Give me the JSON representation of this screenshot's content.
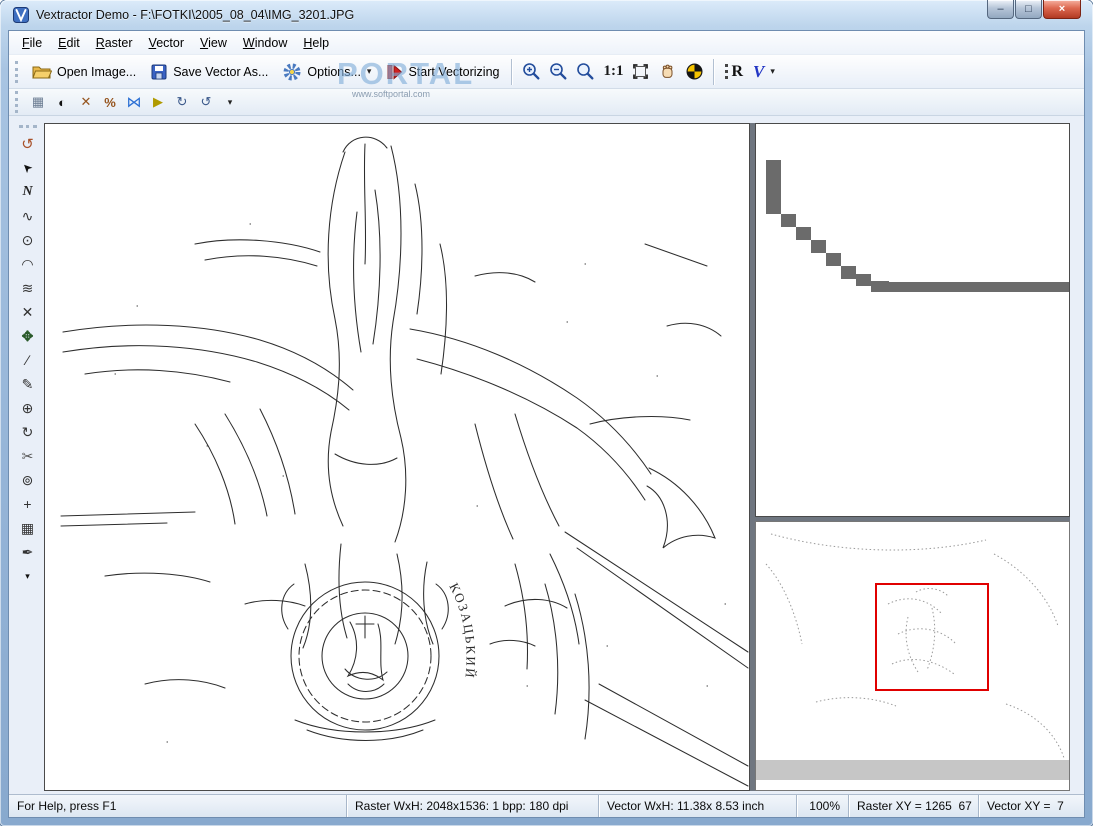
{
  "window": {
    "title": "Vextractor Demo - F:\\FOTKI\\2005_08_04\\IMG_3201.JPG",
    "controls": {
      "minimize": "–",
      "maximize": "□",
      "close": "×"
    }
  },
  "menu": {
    "items": [
      "File",
      "Edit",
      "Raster",
      "Vector",
      "View",
      "Window",
      "Help"
    ]
  },
  "toolbar_main": {
    "open": "Open Image...",
    "save": "Save Vector As...",
    "options": "Options...",
    "start": "Start Vectorizing",
    "zoom_ratio": "1:1",
    "raster_letter": "R",
    "vector_letter": "V",
    "options_arrow": "▾",
    "more_arrow": "▾"
  },
  "toolbar_raster": {
    "items": [
      {
        "name": "raster-cells-icon",
        "glyph": "▦"
      },
      {
        "name": "invert-colors-icon",
        "glyph": "◐"
      },
      {
        "name": "despeckle-icon",
        "glyph": "✕"
      },
      {
        "name": "threshold-icon",
        "glyph": "%"
      },
      {
        "name": "flip-horizontal-icon",
        "glyph": "⋈"
      },
      {
        "name": "play-icon",
        "glyph": "▶"
      },
      {
        "name": "rotate-cw-icon",
        "glyph": "↻"
      },
      {
        "name": "rotate-ccw-icon",
        "glyph": "↺"
      },
      {
        "name": "toolbar-more-arrow",
        "glyph": "▾"
      }
    ]
  },
  "left_toolbar": {
    "items": [
      {
        "name": "undo-icon",
        "glyph": "↺"
      },
      {
        "name": "select-tool-icon",
        "glyph": "➤"
      },
      {
        "name": "polyline-tool-icon",
        "glyph": "N"
      },
      {
        "name": "spline-tool-icon",
        "glyph": "∿"
      },
      {
        "name": "circle-tool-icon",
        "glyph": "⊙"
      },
      {
        "name": "arc-tool-icon",
        "glyph": "◠"
      },
      {
        "name": "curves-tool-icon",
        "glyph": "≋"
      },
      {
        "name": "delete-tool-icon",
        "glyph": "✕"
      },
      {
        "name": "move-tool-icon",
        "glyph": "✥"
      },
      {
        "name": "line-tool-icon",
        "glyph": "∕"
      },
      {
        "name": "pencil-tool-icon",
        "glyph": "✎"
      },
      {
        "name": "node-edit-tool-icon",
        "glyph": "⊕"
      },
      {
        "name": "rotate-tool-icon",
        "glyph": "↻"
      },
      {
        "name": "scissors-tool-icon",
        "glyph": "✂"
      },
      {
        "name": "weld-tool-icon",
        "glyph": "⊚"
      },
      {
        "name": "add-node-tool-icon",
        "glyph": "+"
      },
      {
        "name": "grid-tool-icon",
        "glyph": "▦"
      },
      {
        "name": "ink-pen-tool-icon",
        "glyph": "✒"
      },
      {
        "name": "more-tools-arrow",
        "glyph": "▾"
      }
    ]
  },
  "watermark": {
    "text": "PORTAL",
    "url": "www.softportal.com"
  },
  "canvas": {
    "emblem_text": "КОЗАЦЬКИЙ"
  },
  "statusbar": {
    "help": "For Help, press F1",
    "raster_wxh": "Raster WxH: 2048x1536: 1 bpp: 180 dpi",
    "vector_wxh": "Vector WxH: 11.38x 8.53 inch",
    "zoom": "100%",
    "raster_xy": "Raster XY = 1265  67",
    "vector_xy": "Vector XY =  7"
  }
}
